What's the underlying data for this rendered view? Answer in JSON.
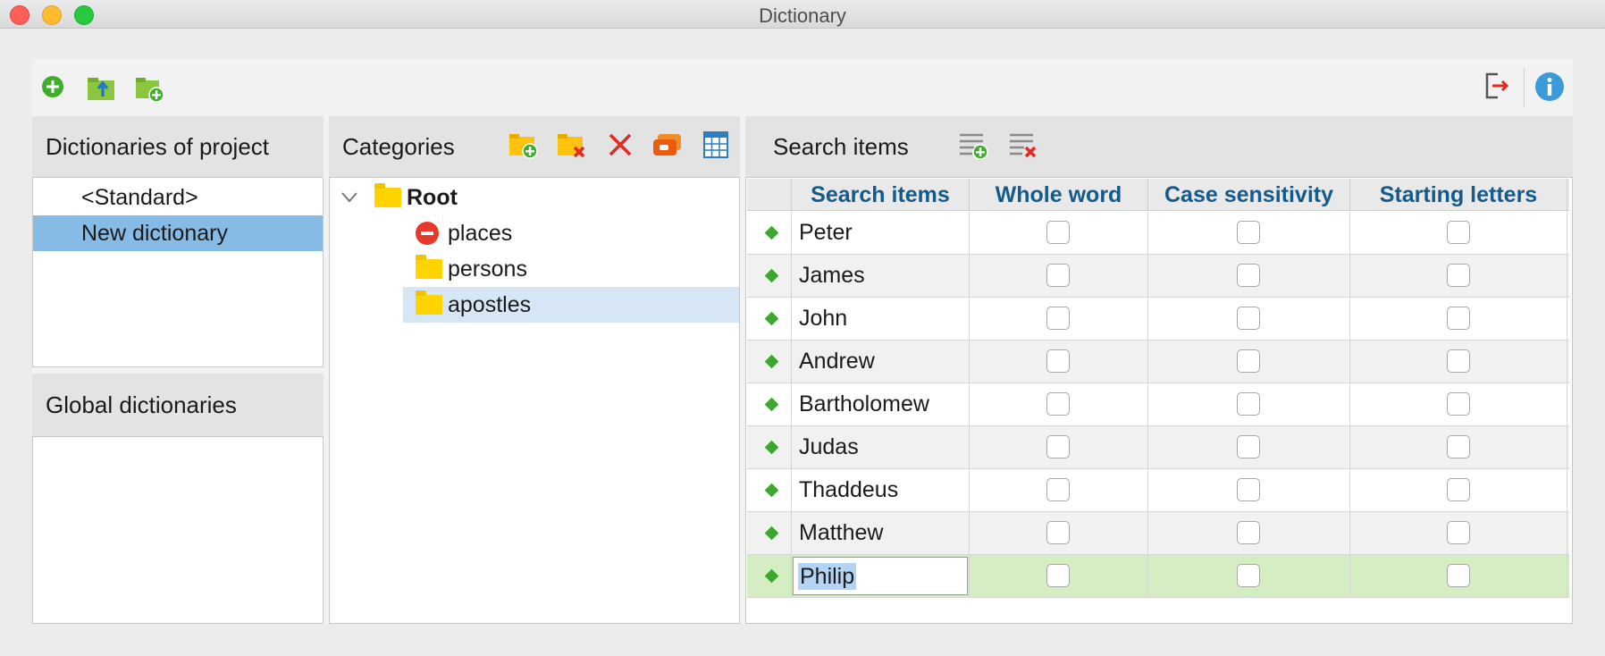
{
  "window": {
    "title": "Dictionary"
  },
  "toolbar": {
    "icons": [
      "add-dictionary-icon",
      "export-dictionary-icon",
      "import-dictionary-icon",
      "exit-icon",
      "info-icon"
    ]
  },
  "dictionaries": {
    "header": "Dictionaries of project",
    "items": [
      "<Standard>",
      "New dictionary"
    ],
    "selected_index": 1
  },
  "global": {
    "header": "Global dictionaries"
  },
  "categories": {
    "header": "Categories",
    "root": "Root",
    "children": [
      "places",
      "persons",
      "apostles"
    ],
    "selected": "apostles"
  },
  "search": {
    "header": "Search items",
    "columns": [
      "Search items",
      "Whole word",
      "Case sensitivity",
      "Starting letters"
    ],
    "rows": [
      {
        "term": "Peter",
        "whole_word": false,
        "case_sensitive": false,
        "starting_letters": false
      },
      {
        "term": "James",
        "whole_word": false,
        "case_sensitive": false,
        "starting_letters": false
      },
      {
        "term": "John",
        "whole_word": false,
        "case_sensitive": false,
        "starting_letters": false
      },
      {
        "term": "Andrew",
        "whole_word": false,
        "case_sensitive": false,
        "starting_letters": false
      },
      {
        "term": "Bartholomew",
        "whole_word": false,
        "case_sensitive": false,
        "starting_letters": false
      },
      {
        "term": "Judas",
        "whole_word": false,
        "case_sensitive": false,
        "starting_letters": false
      },
      {
        "term": "Thaddeus",
        "whole_word": false,
        "case_sensitive": false,
        "starting_letters": false
      },
      {
        "term": "Matthew",
        "whole_word": false,
        "case_sensitive": false,
        "starting_letters": false
      },
      {
        "term": "Philip",
        "whole_word": false,
        "case_sensitive": false,
        "starting_letters": false
      }
    ],
    "editing_index": 8
  },
  "colors": {
    "selection_blue": "#86bbe6",
    "header_text": "#145a8c",
    "active_row": "#d5edc2",
    "accent_green": "#3aa82c"
  }
}
